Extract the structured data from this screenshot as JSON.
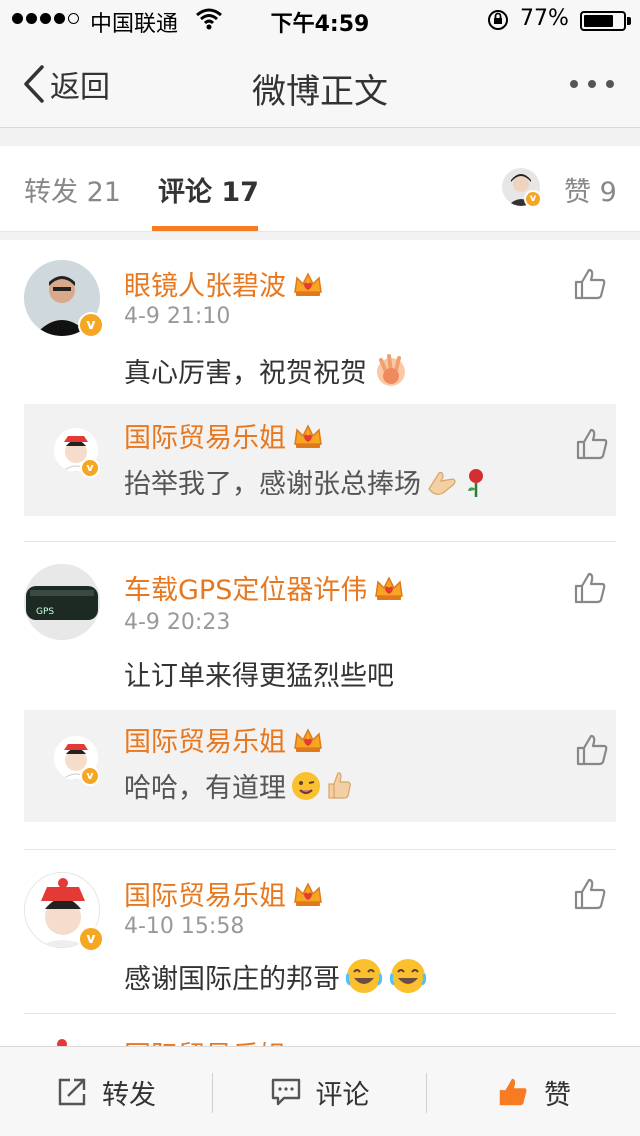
{
  "status_bar": {
    "carrier": "中国联通",
    "time": "下午4:59",
    "battery": "77%",
    "battery_level": 0.77
  },
  "nav": {
    "back_label": "返回",
    "title": "微博正文"
  },
  "tabs": {
    "repost": "转发 21",
    "comment": "评论 17",
    "like": "赞 9"
  },
  "comments": [
    {
      "name": "眼镜人张碧波",
      "time": "4-9 21:10",
      "text": "真心厉害，祝贺祝贺",
      "reply": {
        "name": "国际贸易乐姐",
        "text": "抬举我了，感谢张总捧场"
      }
    },
    {
      "name": "车载GPS定位器许伟",
      "time": "4-9 20:23",
      "text": "让订单来得更猛烈些吧",
      "reply": {
        "name": "国际贸易乐姐",
        "text": "哈哈，有道理"
      }
    },
    {
      "name": "国际贸易乐姐",
      "time": "4-10 15:58",
      "text": "感谢国际庄的邦哥"
    },
    {
      "name": "国际贸易乐姐"
    }
  ],
  "toolbar": {
    "repost": "转发",
    "comment": "评论",
    "like": "赞"
  },
  "colors": {
    "accent": "#f77b23",
    "name": "#e8781f",
    "verified": "#f5a623"
  },
  "icons": [
    "back-arrow-icon",
    "more-icon",
    "thumb-up-icon",
    "crown-icon",
    "verified-badge-icon",
    "repost-icon",
    "comment-icon",
    "emoji-clap-icon",
    "emoji-rose-icon",
    "emoji-wink-icon",
    "emoji-laugh-icon"
  ]
}
